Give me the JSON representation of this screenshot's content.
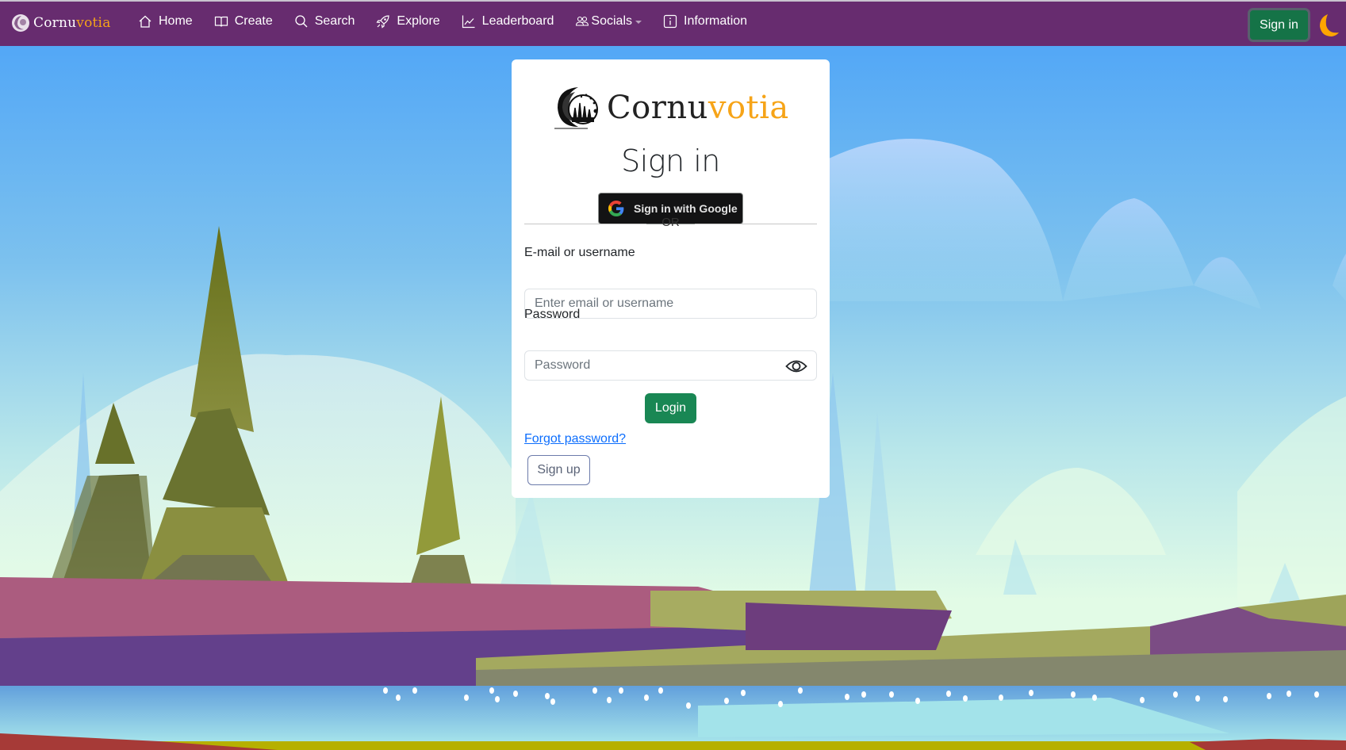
{
  "brand": {
    "name_main": "Cornu",
    "name_accent": "votia",
    "accent_color": "#f6a418",
    "navbar_color": "#672c6f"
  },
  "nav": {
    "items": [
      {
        "label": "Home",
        "icon": "home-icon"
      },
      {
        "label": "Create",
        "icon": "book-icon"
      },
      {
        "label": "Search",
        "icon": "search-icon"
      },
      {
        "label": "Explore",
        "icon": "rocket-icon"
      },
      {
        "label": "Leaderboard",
        "icon": "chart-line-icon"
      },
      {
        "label": "Socials",
        "icon": "people-icon",
        "dropdown": true
      },
      {
        "label": "Information",
        "icon": "info-icon"
      }
    ],
    "signin_label": "Sign in",
    "theme_toggle_icon": "moon-icon"
  },
  "card": {
    "title": "Sign in",
    "google_button_label": "Sign in with Google",
    "divider_text": "OR",
    "email_label": "E-mail or username",
    "email_placeholder": "Enter email or username",
    "email_value": "",
    "password_label": "Password",
    "password_placeholder": "Password",
    "password_value": "",
    "login_label": "Login",
    "forgot_label": "Forgot password?",
    "signup_label": "Sign up"
  }
}
